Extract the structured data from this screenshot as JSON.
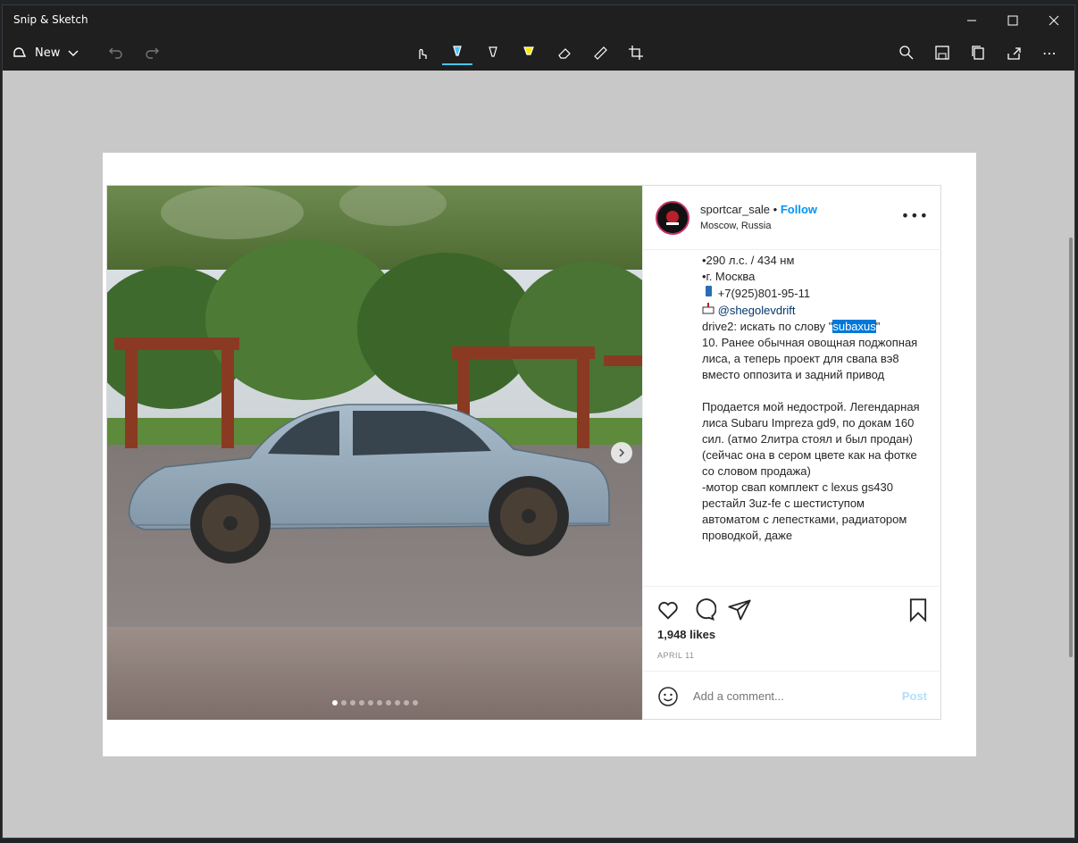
{
  "window": {
    "title": "Snip & Sketch"
  },
  "toolbar": {
    "new_label": "New"
  },
  "post": {
    "username": "sportcar_sale",
    "separator": "•",
    "follow": "Follow",
    "location": "Moscow, Russia",
    "caption_lines": [
      "•290 л.с. / 434 нм",
      "•г. Москва",
      "+7(925)801-95-11",
      "@shegolevdrift",
      "",
      "drive2: искать по слову \"",
      "subaxus",
      "\"",
      "10. Ранее обычная овощная поджопная лиса, а теперь проект для свапа вэ8 вместо оппозита и задний привод",
      "Продается мой недострой. Легендарная лиса Subaru Impreza gd9, по докам 160 сил. (атмо 2литра стоял и был продан) (сейчас она в сером цвете как на фотке со словом продажа)",
      "-мотор свап комплект с lexus gs430 рестайл 3uz-fe с шестиступом автоматом с лепестками, радиатором проводкой, даже"
    ],
    "likes": "1,948 likes",
    "date": "APRIL 11",
    "comment_placeholder": "Add a comment...",
    "post_button": "Post",
    "carousel": {
      "total": 10,
      "active": 0
    }
  },
  "colors": {
    "accent": "#0095f6",
    "selection": "#0078d7"
  }
}
